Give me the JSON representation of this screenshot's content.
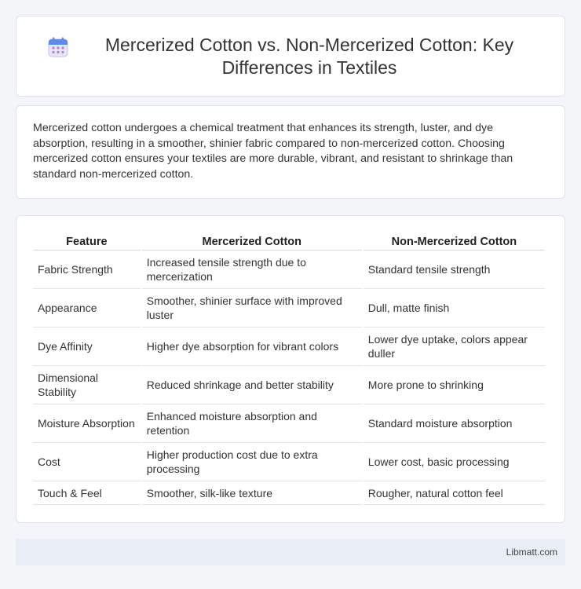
{
  "header": {
    "title": "Mercerized Cotton vs. Non-Mercerized Cotton: Key Differences in Textiles",
    "icon": "calendar-icon"
  },
  "intro": {
    "text": "Mercerized cotton undergoes a chemical treatment that enhances its strength, luster, and dye absorption, resulting in a smoother, shinier fabric compared to non-mercerized cotton. Choosing mercerized cotton ensures your textiles are more durable, vibrant, and resistant to shrinkage than standard non-mercerized cotton."
  },
  "table": {
    "headers": [
      "Feature",
      "Mercerized Cotton",
      "Non-Mercerized Cotton"
    ],
    "rows": [
      [
        "Fabric Strength",
        "Increased tensile strength due to mercerization",
        "Standard tensile strength"
      ],
      [
        "Appearance",
        "Smoother, shinier surface with improved luster",
        "Dull, matte finish"
      ],
      [
        "Dye Affinity",
        "Higher dye absorption for vibrant colors",
        "Lower dye uptake, colors appear duller"
      ],
      [
        "Dimensional Stability",
        "Reduced shrinkage and better stability",
        "More prone to shrinking"
      ],
      [
        "Moisture Absorption",
        "Enhanced moisture absorption and retention",
        "Standard moisture absorption"
      ],
      [
        "Cost",
        "Higher production cost due to extra processing",
        "Lower cost, basic processing"
      ],
      [
        "Touch & Feel",
        "Smoother, silk-like texture",
        "Rougher, natural cotton feel"
      ]
    ]
  },
  "footer": {
    "site": "Libmatt.com"
  }
}
